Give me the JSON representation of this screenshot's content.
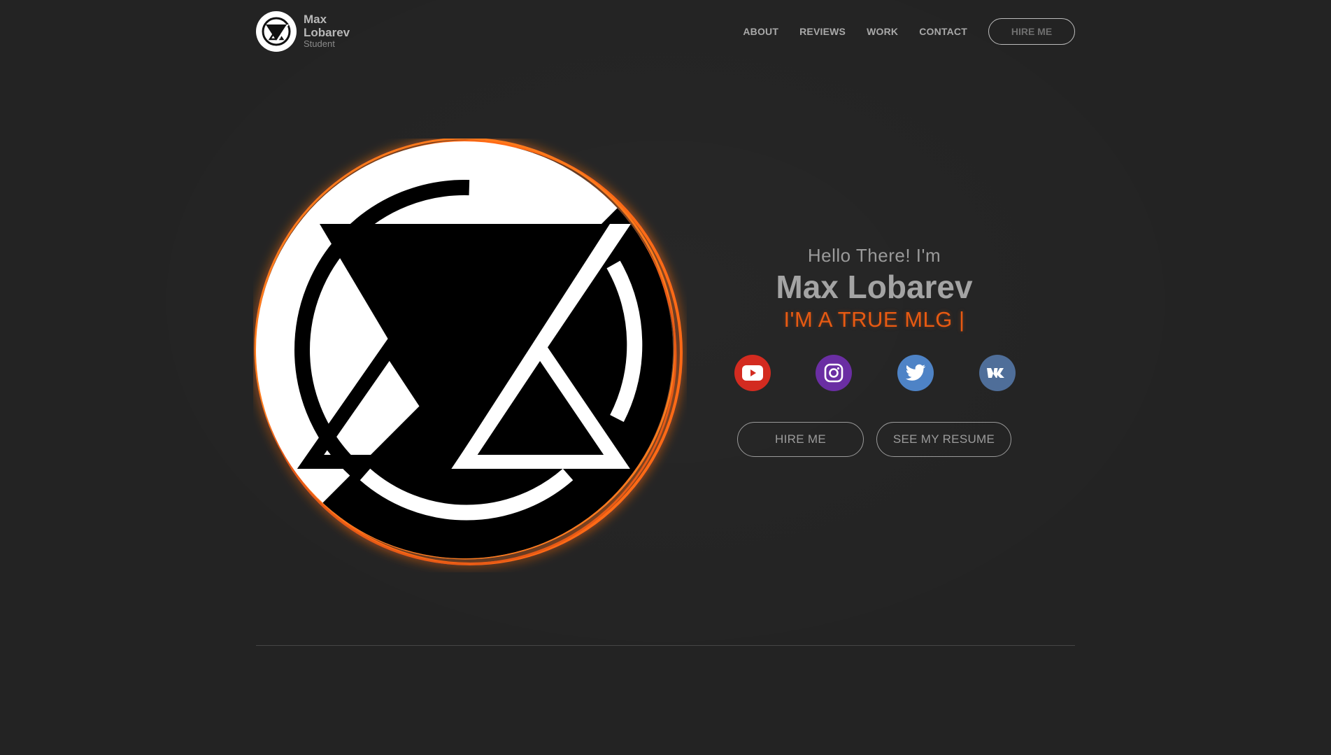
{
  "brand": {
    "name": "Max Lobarev",
    "role": "Student",
    "logo_icon": "triangle-x-logo-icon"
  },
  "nav": {
    "items": [
      "ABOUT",
      "REVIEWS",
      "WORK",
      "CONTACT"
    ],
    "hire_label": "HIRE ME"
  },
  "hero": {
    "greeting": "Hello There! I'm",
    "name": "Max Lobarev",
    "tagline": "I'M A TRUE MLG |",
    "avatar_icon": "triangle-x-emblem-icon",
    "glow_color": "#ff6a13"
  },
  "socials": [
    {
      "name": "youtube",
      "icon": "youtube-icon",
      "color": "#d32b20"
    },
    {
      "name": "instagram",
      "icon": "instagram-icon",
      "color": "#6a2ea3"
    },
    {
      "name": "twitter",
      "icon": "twitter-icon",
      "color": "#4e83c6"
    },
    {
      "name": "vk",
      "icon": "vk-icon",
      "color": "#4f6e99"
    }
  ],
  "actions": {
    "hire_label": "HIRE ME",
    "resume_label": "SEE MY RESUME"
  },
  "colors": {
    "background": "#232323",
    "accent": "#e85a12"
  }
}
